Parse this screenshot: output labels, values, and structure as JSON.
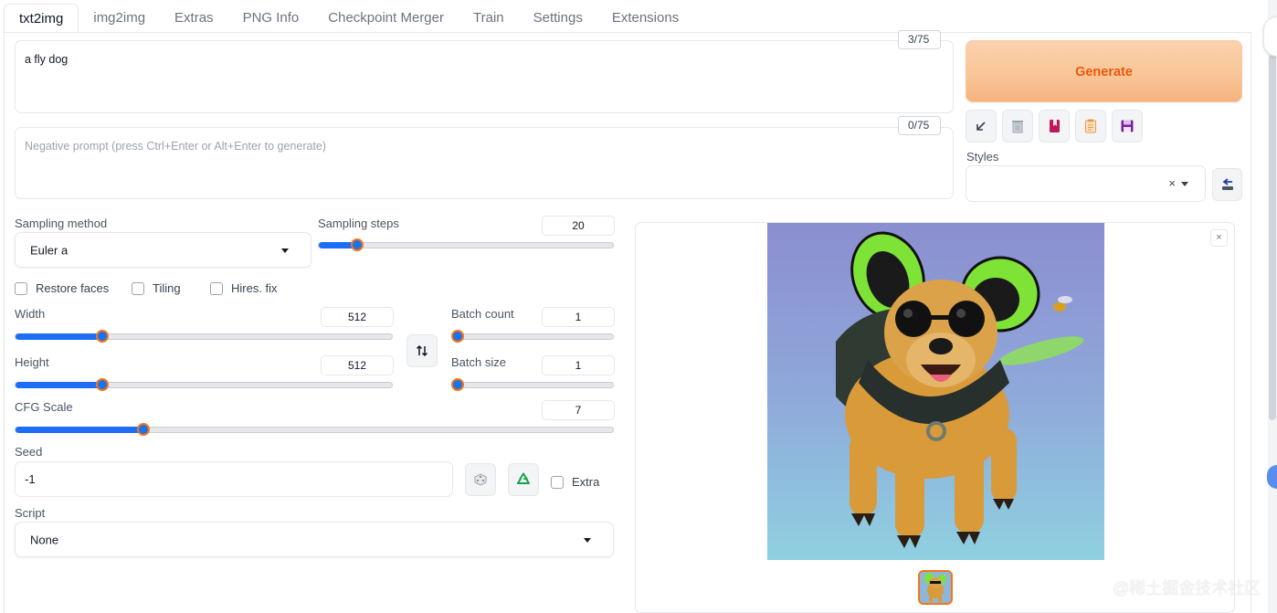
{
  "tabs": [
    {
      "label": "txt2img",
      "active": true
    },
    {
      "label": "img2img"
    },
    {
      "label": "Extras"
    },
    {
      "label": "PNG Info"
    },
    {
      "label": "Checkpoint Merger"
    },
    {
      "label": "Train"
    },
    {
      "label": "Settings"
    },
    {
      "label": "Extensions"
    }
  ],
  "prompt": {
    "value": "a fly dog",
    "token_count": "3/75"
  },
  "negative_prompt": {
    "value": "",
    "placeholder": "Negative prompt (press Ctrl+Enter or Alt+Enter to generate)",
    "token_count": "0/75"
  },
  "generate": {
    "label": "Generate",
    "color": "#ea580c"
  },
  "toolbar": {
    "icons": [
      "arrow-down-left-icon",
      "trash-icon",
      "bookmark-icon",
      "clipboard-icon",
      "save-icon"
    ]
  },
  "styles": {
    "label": "Styles",
    "clear_symbol": "×"
  },
  "sampling": {
    "method_label": "Sampling method",
    "method_value": "Euler a",
    "steps_label": "Sampling steps",
    "steps_value": "20",
    "steps_fraction": 0.13
  },
  "checkboxes": {
    "restore_faces": "Restore faces",
    "tiling": "Tiling",
    "hires_fix": "Hires. fix",
    "extra": "Extra"
  },
  "size": {
    "width_label": "Width",
    "width_value": "512",
    "width_fraction": 0.23,
    "height_label": "Height",
    "height_value": "512",
    "height_fraction": 0.23
  },
  "batch": {
    "count_label": "Batch count",
    "count_value": "1",
    "count_fraction": 0.0,
    "size_label": "Batch size",
    "size_value": "1",
    "size_fraction": 0.0
  },
  "cfg": {
    "label": "CFG Scale",
    "value": "7",
    "fraction": 0.214
  },
  "seed": {
    "label": "Seed",
    "value": "-1"
  },
  "script": {
    "label": "Script",
    "value": "None"
  },
  "gallery": {
    "close_symbol": "×"
  },
  "watermark": "@稀土掘金技术社区",
  "colors": {
    "accent": "#1a73e8",
    "generate_bg": "#f8c698"
  }
}
